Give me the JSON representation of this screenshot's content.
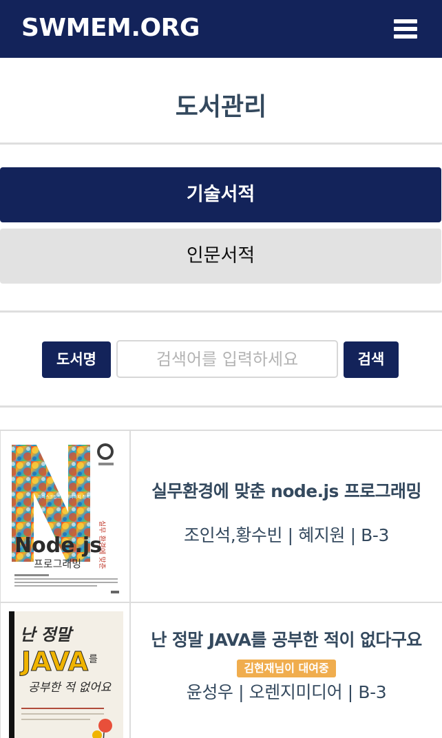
{
  "header": {
    "brand": "SWMEM.ORG",
    "menu_icon": "hamburger-menu-icon"
  },
  "page": {
    "title": "도서관리"
  },
  "categories": [
    {
      "label": "기술서적",
      "active": true
    },
    {
      "label": "인문서적",
      "active": false
    }
  ],
  "search": {
    "type_label": "도서명",
    "value": "",
    "placeholder": "검색어를 입력하세요",
    "button_label": "검색"
  },
  "books": [
    {
      "title": "실무환경에 맞춘 node.js 프로그래밍",
      "meta": "조인석,황수빈 | 혜지원 | B-3",
      "status": "",
      "cover": {
        "big_letter": "N",
        "brand_text": "Node.js",
        "sub_text": "프로그래밍",
        "side_text": "실무 환경에 맞춘",
        "badge_text": "자바스크립트로 서버까지 정복하자"
      }
    },
    {
      "title": "난 정말 JAVA를 공부한 적이 없다구요",
      "meta": "윤성우 | 오렌지미디어 | B-3",
      "status": "김현재님이 대여중",
      "cover": {
        "line1": "난 정말",
        "line2": "JAVA",
        "line3": "를",
        "line4": "공부한 적 없어요"
      }
    }
  ],
  "colors": {
    "navy": "#13235a",
    "text": "#34495e",
    "loan_badge": "#f0ad4e",
    "inactive_tab": "#e2e2e2"
  }
}
